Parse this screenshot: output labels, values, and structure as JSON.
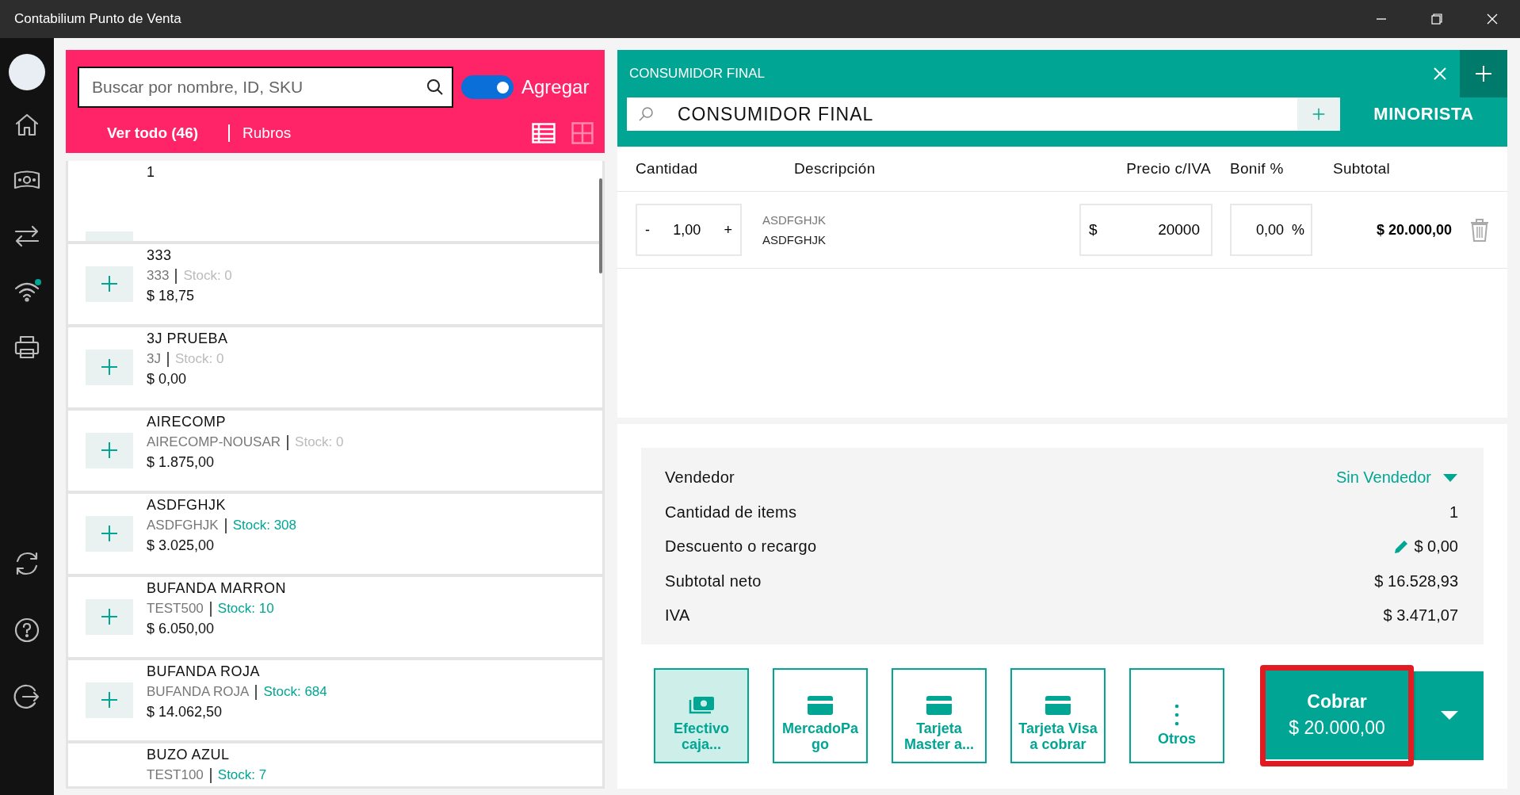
{
  "window": {
    "title": "Contabilium Punto de Venta"
  },
  "sidebar": {
    "wifi_online": true
  },
  "catalog": {
    "search": {
      "placeholder": "Buscar por nombre, ID, SKU"
    },
    "add_toggle": {
      "label": "Agregar",
      "on": true
    },
    "tabs": [
      {
        "label": "Ver todo (46)",
        "selected": true
      },
      {
        "label": "Rubros",
        "selected": false
      }
    ],
    "views": [
      {
        "kind": "list",
        "selected": true
      },
      {
        "kind": "grid",
        "selected": false
      }
    ],
    "products": [
      {
        "name": "1"
      },
      {
        "name": "333",
        "sku": "333",
        "stock": "Stock: 0",
        "available": false,
        "price": "$ 18,75"
      },
      {
        "name": "3J PRUEBA",
        "sku": "3J",
        "stock": "Stock: 0",
        "available": false,
        "price": "$ 0,00"
      },
      {
        "name": "AIRECOMP",
        "sku": "AIRECOMP-NOUSAR",
        "stock": "Stock: 0",
        "available": false,
        "price": "$ 1.875,00"
      },
      {
        "name": "ASDFGHJK",
        "sku": "ASDFGHJK",
        "stock": "Stock: 308",
        "available": true,
        "price": "$ 3.025,00"
      },
      {
        "name": "BUFANDA MARRON",
        "sku": "TEST500",
        "stock": "Stock: 10",
        "available": true,
        "price": "$ 6.050,00"
      },
      {
        "name": "BUFANDA ROJA",
        "sku": "BUFANDA ROJA",
        "stock": "Stock: 684",
        "available": true,
        "price": "$ 14.062,50"
      },
      {
        "name": "BUZO AZUL",
        "sku": "TEST100",
        "stock": "Stock: 7",
        "available": true
      }
    ]
  },
  "sale": {
    "tab_title": "CONSUMIDOR FINAL",
    "customer": {
      "value": "CONSUMIDOR FINAL"
    },
    "price_list": "MINORISTA",
    "columns": [
      "Cantidad",
      "Descripción",
      "Precio c/IVA",
      "Bonif %",
      "Subtotal"
    ],
    "rows": [
      {
        "quantity": "1,00",
        "minus": "-",
        "plus": "+",
        "code": "ASDFGHJK",
        "description": "ASDFGHJK",
        "currency": "$",
        "price": "20000",
        "discount": "0,00",
        "percent": "%",
        "subtotal": "$ 20.000,00"
      }
    ],
    "summary": [
      {
        "kind": "select",
        "label": "Vendedor",
        "value": "Sin Vendedor"
      },
      {
        "kind": "plain",
        "label": "Cantidad de items",
        "value": "1"
      },
      {
        "kind": "edit",
        "label": "Descuento o recargo",
        "value": "$ 0,00"
      },
      {
        "kind": "plain",
        "label": "Subtotal neto",
        "value": "$ 16.528,93"
      },
      {
        "kind": "plain",
        "label": "IVA",
        "value": "$ 3.471,07"
      }
    ],
    "payments": [
      {
        "kind": "cash",
        "label": "Efectivo caja...",
        "selected": true
      },
      {
        "kind": "card",
        "label": "MercadoPa go",
        "selected": false
      },
      {
        "kind": "card",
        "label": "Tarjeta Master a...",
        "selected": false
      },
      {
        "kind": "card",
        "label": "Tarjeta Visa a cobrar",
        "selected": false
      },
      {
        "kind": "more",
        "label": "Otros",
        "selected": false
      }
    ],
    "charge": {
      "label": "Cobrar",
      "amount": "$ 20.000,00",
      "highlighted": true
    }
  }
}
